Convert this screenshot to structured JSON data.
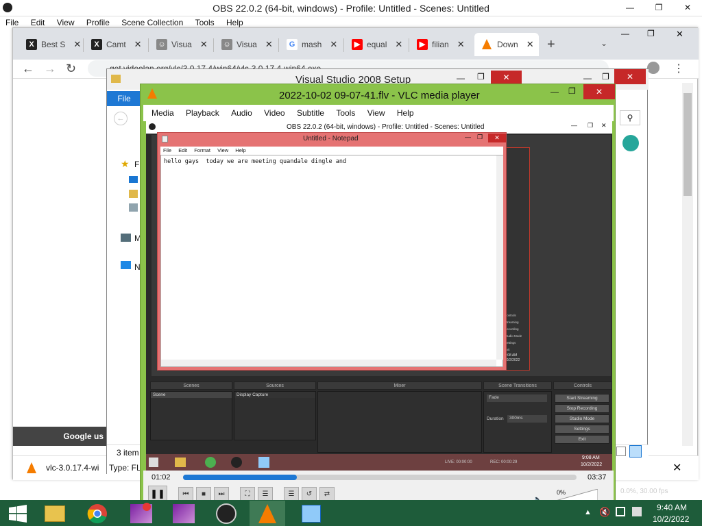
{
  "obs": {
    "title": "OBS 22.0.2 (64-bit, windows) - Profile: Untitled - Scenes: Untitled",
    "menu": [
      "File",
      "Edit",
      "View",
      "Profile",
      "Scene Collection",
      "Tools",
      "Help"
    ],
    "bg_status": "0.0%, 30.00 fps"
  },
  "chrome": {
    "tabs": [
      "Best S",
      "Camt",
      "Visua",
      "Visua",
      "mash",
      "equal",
      "filian",
      "Down"
    ],
    "address": "get.videolan.org/vlc/3.0.17.4/win64/vlc-3.0.17.4-win64.exe",
    "bottom_banner": "Google us",
    "download_name": "vlc-3.0.17.4-wi",
    "items_count": "3 item",
    "type_text": "Type: FL"
  },
  "vs_setup": {
    "title": "Visual Studio 2008 Setup",
    "file_tab": "File",
    "nav_letters": [
      "F",
      "M",
      "N"
    ]
  },
  "vlc": {
    "title": "2022-10-02 09-07-41.flv - VLC media player",
    "menu": [
      "Media",
      "Playback",
      "Audio",
      "Video",
      "Subtitle",
      "Tools",
      "View",
      "Help"
    ],
    "time_elapsed": "01:02",
    "time_total": "03:37",
    "progress": 0.29,
    "volume": "0%"
  },
  "inner_obs": {
    "title": "OBS 22.0.2 (64-bit, windows) - Profile: Untitled - Scenes: Untitled",
    "panels": {
      "scenes": "Scenes",
      "sources": "Sources",
      "mixer": "Mixer",
      "transitions": "Scene Transitions",
      "controls": "Controls"
    },
    "scene_item": "Scene",
    "source_item": "Display Capture",
    "transition": "Fade",
    "duration_label": "Duration",
    "duration_value": "300ms",
    "buttons": [
      "Start Streaming",
      "Stop Recording",
      "Studio Mode",
      "Settings",
      "Exit"
    ],
    "right_buttons": [
      "Controls",
      "Streaming",
      "Recording",
      "Studio Mode",
      "Settings",
      "Exit"
    ],
    "status_live": "LIVE: 00:00:00",
    "status_rec": "REC: 00:00:29",
    "inner_clock_time": "9:08 AM",
    "inner_clock_date": "10/2/2022"
  },
  "notepad": {
    "title": "Untitled - Notepad",
    "menu": [
      "File",
      "Edit",
      "Format",
      "View",
      "Help"
    ],
    "content": "hello gays  today we are meeting quandale dingle and"
  },
  "taskbar": {
    "time": "9:40 AM",
    "date": "10/2/2022"
  },
  "colors": {
    "vlc_frame": "#8bc34a",
    "notepad_frame": "#e57373",
    "taskbar": "#1e5c3a",
    "chrome_tabs": "#dee1e6"
  }
}
